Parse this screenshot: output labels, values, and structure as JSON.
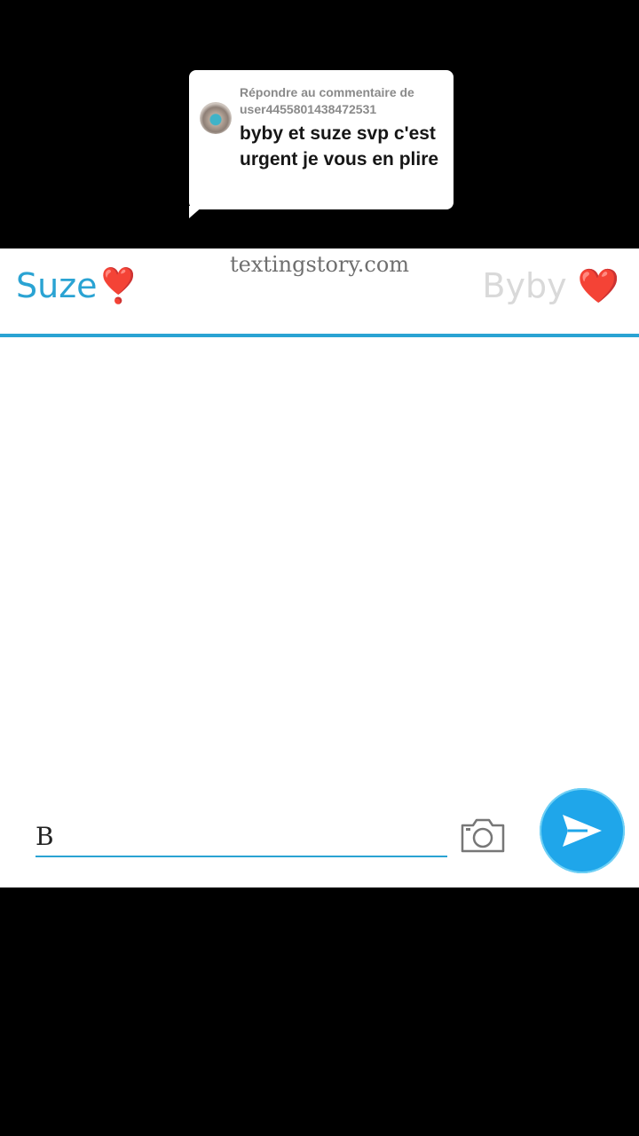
{
  "reply": {
    "header_line1": "Répondre au commentaire de",
    "header_line2": "user4455801438472531",
    "message": "byby et suze svp c'est urgent je vous en plire"
  },
  "header": {
    "watermark": "textingstory.com",
    "left_contact": "Suze",
    "left_emoji": "❣️",
    "right_contact": "Byby",
    "right_emoji": "❤️"
  },
  "composer": {
    "input_value": "B"
  },
  "colors": {
    "accent": "#2aa3d3",
    "send_button": "#1fa6ea",
    "inactive_contact": "#d9d9d9"
  },
  "icons": {
    "avatar": "avatar",
    "camera": "camera-icon",
    "send": "send-icon"
  }
}
